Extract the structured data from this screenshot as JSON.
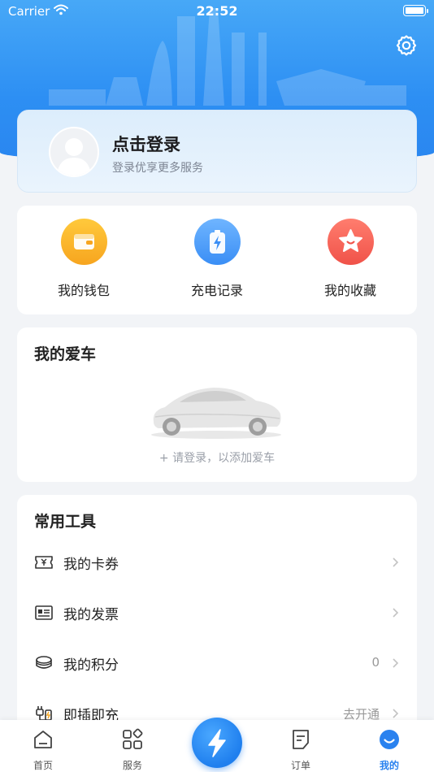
{
  "status_bar": {
    "carrier": "Carrier",
    "time": "22:52"
  },
  "login": {
    "title": "点击登录",
    "subtitle": "登录优享更多服务"
  },
  "quick_actions": [
    {
      "label": "我的钱包",
      "icon": "wallet-icon",
      "color": "#f7a51f"
    },
    {
      "label": "充电记录",
      "icon": "battery-charge-icon",
      "color": "#3a8ef5"
    },
    {
      "label": "我的收藏",
      "icon": "star-icon",
      "color": "#f05249"
    }
  ],
  "my_car": {
    "title": "我的爱车",
    "hint": "+ 请登录，以添加爱车"
  },
  "tools": {
    "title": "常用工具",
    "items": [
      {
        "label": "我的卡券",
        "value": "",
        "icon": "coupon-icon"
      },
      {
        "label": "我的发票",
        "value": "",
        "icon": "invoice-icon"
      },
      {
        "label": "我的积分",
        "value": "0",
        "icon": "points-icon"
      },
      {
        "label": "即插即充",
        "value": "去开通",
        "icon": "plug-icon"
      }
    ]
  },
  "tabbar": {
    "items": [
      {
        "label": "首页",
        "icon": "home-icon"
      },
      {
        "label": "服务",
        "icon": "services-icon"
      },
      {
        "label": "",
        "icon": "lightning-icon"
      },
      {
        "label": "订单",
        "icon": "order-icon"
      },
      {
        "label": "我的",
        "icon": "profile-icon",
        "active": true
      }
    ]
  },
  "colors": {
    "primary": "#2a82ef",
    "background": "#f2f4f7"
  }
}
